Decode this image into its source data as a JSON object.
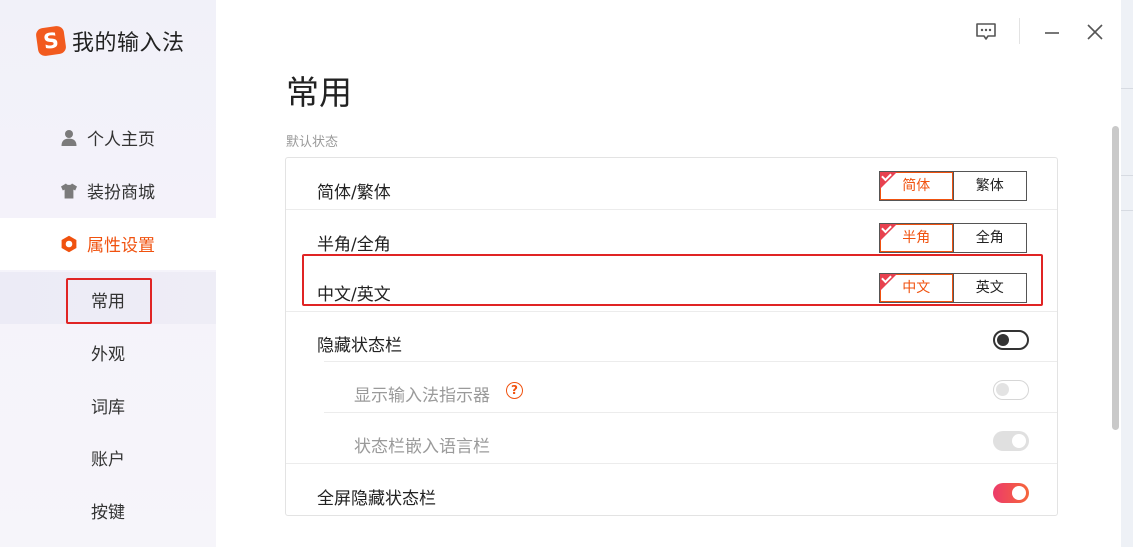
{
  "app": {
    "name": "我的输入法",
    "logo_letter": "S",
    "accent": "#f0520f"
  },
  "sidebar": {
    "items": [
      {
        "label": "个人主页",
        "icon": "user-icon"
      },
      {
        "label": "装扮商城",
        "icon": "shirt-icon"
      },
      {
        "label": "属性设置",
        "icon": "settings-hexagon-icon"
      }
    ],
    "subitems": [
      {
        "label": "常用"
      },
      {
        "label": "外观"
      },
      {
        "label": "词库"
      },
      {
        "label": "账户"
      },
      {
        "label": "按键"
      }
    ]
  },
  "titlebar": {
    "icons": [
      "feedback-icon",
      "minimize-icon",
      "close-icon"
    ]
  },
  "main": {
    "title": "常用",
    "section_title": "默认状态",
    "rows": [
      {
        "label": "简体/繁体",
        "options": [
          "简体",
          "繁体"
        ],
        "selected": "简体"
      },
      {
        "label": "半角/全角",
        "options": [
          "半角",
          "全角"
        ],
        "selected": "半角"
      },
      {
        "label": "中文/英文",
        "options": [
          "中文",
          "英文"
        ],
        "selected": "中文"
      },
      {
        "label": "隐藏状态栏",
        "toggle": "off"
      },
      {
        "label": "显示输入法指示器",
        "help": "?",
        "toggle": "off",
        "disabled": true
      },
      {
        "label": "状态栏嵌入语言栏",
        "toggle": "on",
        "disabled": true
      },
      {
        "label": "全屏隐藏状态栏",
        "toggle": "on"
      }
    ]
  }
}
